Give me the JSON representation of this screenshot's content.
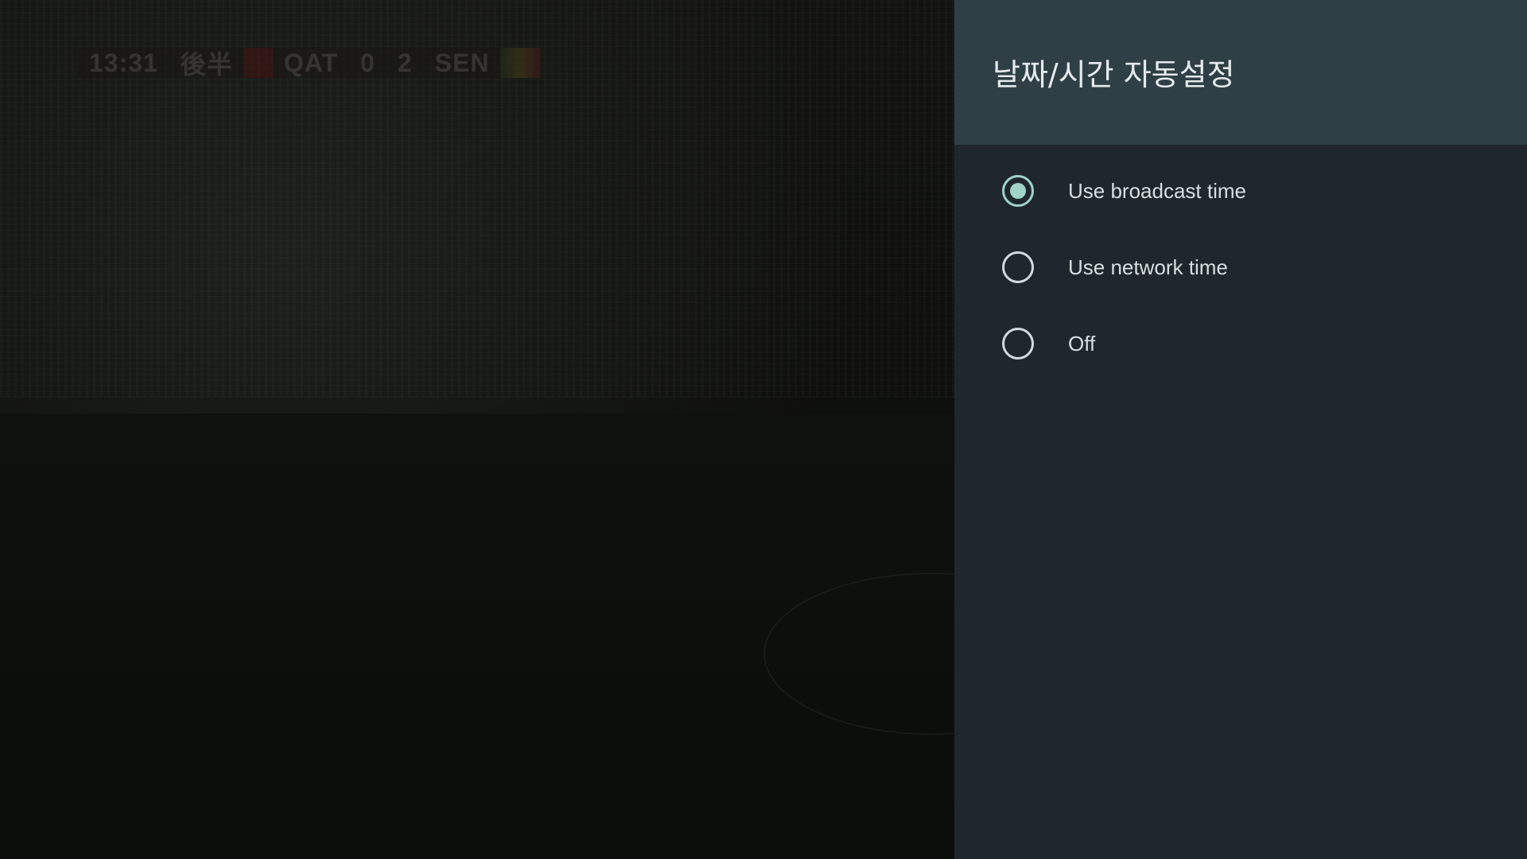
{
  "tv": {
    "scorebug": {
      "clock": "13:31",
      "period": "後半",
      "home_team": "QAT",
      "home_score": "0",
      "away_score": "2",
      "away_team": "SEN"
    }
  },
  "panel": {
    "title": "날짜/시간 자동설정",
    "options": [
      {
        "label": "Use broadcast time",
        "selected": true
      },
      {
        "label": "Use network time",
        "selected": false
      },
      {
        "label": "Off",
        "selected": false
      }
    ],
    "colors": {
      "header_bg": "#2f3f46",
      "panel_bg": "#1f272d",
      "accent": "#9fd4c6"
    }
  }
}
